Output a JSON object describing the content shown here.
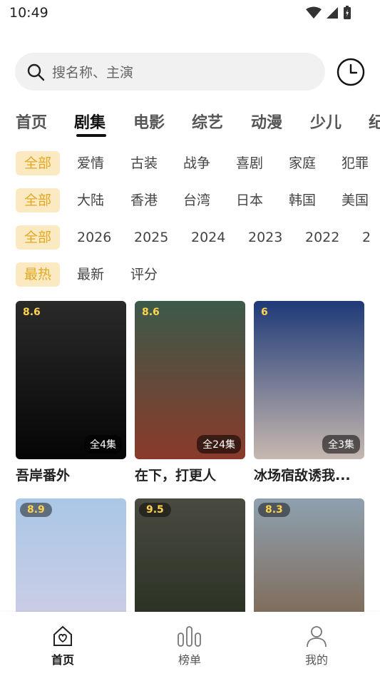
{
  "status": {
    "time": "10:49"
  },
  "search": {
    "placeholder": "搜名称、主演"
  },
  "top_tabs": [
    "首页",
    "剧集",
    "电影",
    "综艺",
    "动漫",
    "少儿",
    "纪"
  ],
  "filters": {
    "genre": [
      "全部",
      "爱情",
      "古装",
      "战争",
      "喜剧",
      "家庭",
      "犯罪"
    ],
    "region": [
      "全部",
      "大陆",
      "香港",
      "台湾",
      "日本",
      "韩国",
      "美国"
    ],
    "year": [
      "全部",
      "2026",
      "2025",
      "2024",
      "2023",
      "2022",
      "2"
    ],
    "sort": [
      "最热",
      "最新",
      "评分"
    ]
  },
  "shows": [
    {
      "title": "吾岸番外",
      "rating": "8.6",
      "episodes": "全4集",
      "color_top": "#2a2a2a",
      "color_bottom": "#050505"
    },
    {
      "title": "在下，打更人",
      "rating": "8.6",
      "episodes": "全24集",
      "color_top": "#3c5a4a",
      "color_bottom": "#8a3a2a"
    },
    {
      "title": "冰场宿敌诱我...",
      "rating": "6",
      "episodes": "全3集",
      "color_top": "#1e3a78",
      "color_bottom": "#c7b8b0"
    },
    {
      "title": "",
      "rating": "8.9",
      "episodes": "",
      "color_top": "#a9c7e6",
      "color_bottom": "#d7cfe6"
    },
    {
      "title": "",
      "rating": "9.5",
      "episodes": "",
      "color_top": "#4a4a40",
      "color_bottom": "#1f2a1a"
    },
    {
      "title": "",
      "rating": "8.3",
      "episodes": "",
      "color_top": "#8ea0b0",
      "color_bottom": "#7a5a3a"
    }
  ],
  "bottom_nav": [
    {
      "label": "首页",
      "icon": "home-heart-icon"
    },
    {
      "label": "榜单",
      "icon": "chart-bars-icon"
    },
    {
      "label": "我的",
      "icon": "user-icon"
    }
  ]
}
